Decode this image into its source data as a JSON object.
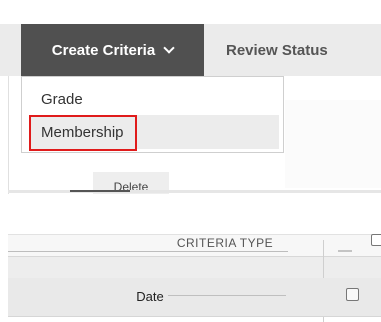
{
  "tabs": {
    "create_criteria": "Create Criteria",
    "review_status": "Review Status"
  },
  "menu": {
    "items": [
      {
        "label": "Grade"
      },
      {
        "label": "Membership"
      }
    ]
  },
  "toolbar": {
    "delete_label": "Delete"
  },
  "table": {
    "header": "CRITERIA TYPE",
    "rows": [
      {
        "type": "Date"
      }
    ]
  },
  "colors": {
    "active_tab": "#505050",
    "highlight": "#e01b1b"
  },
  "icons": {
    "dropdown": "chevron-down-icon"
  }
}
